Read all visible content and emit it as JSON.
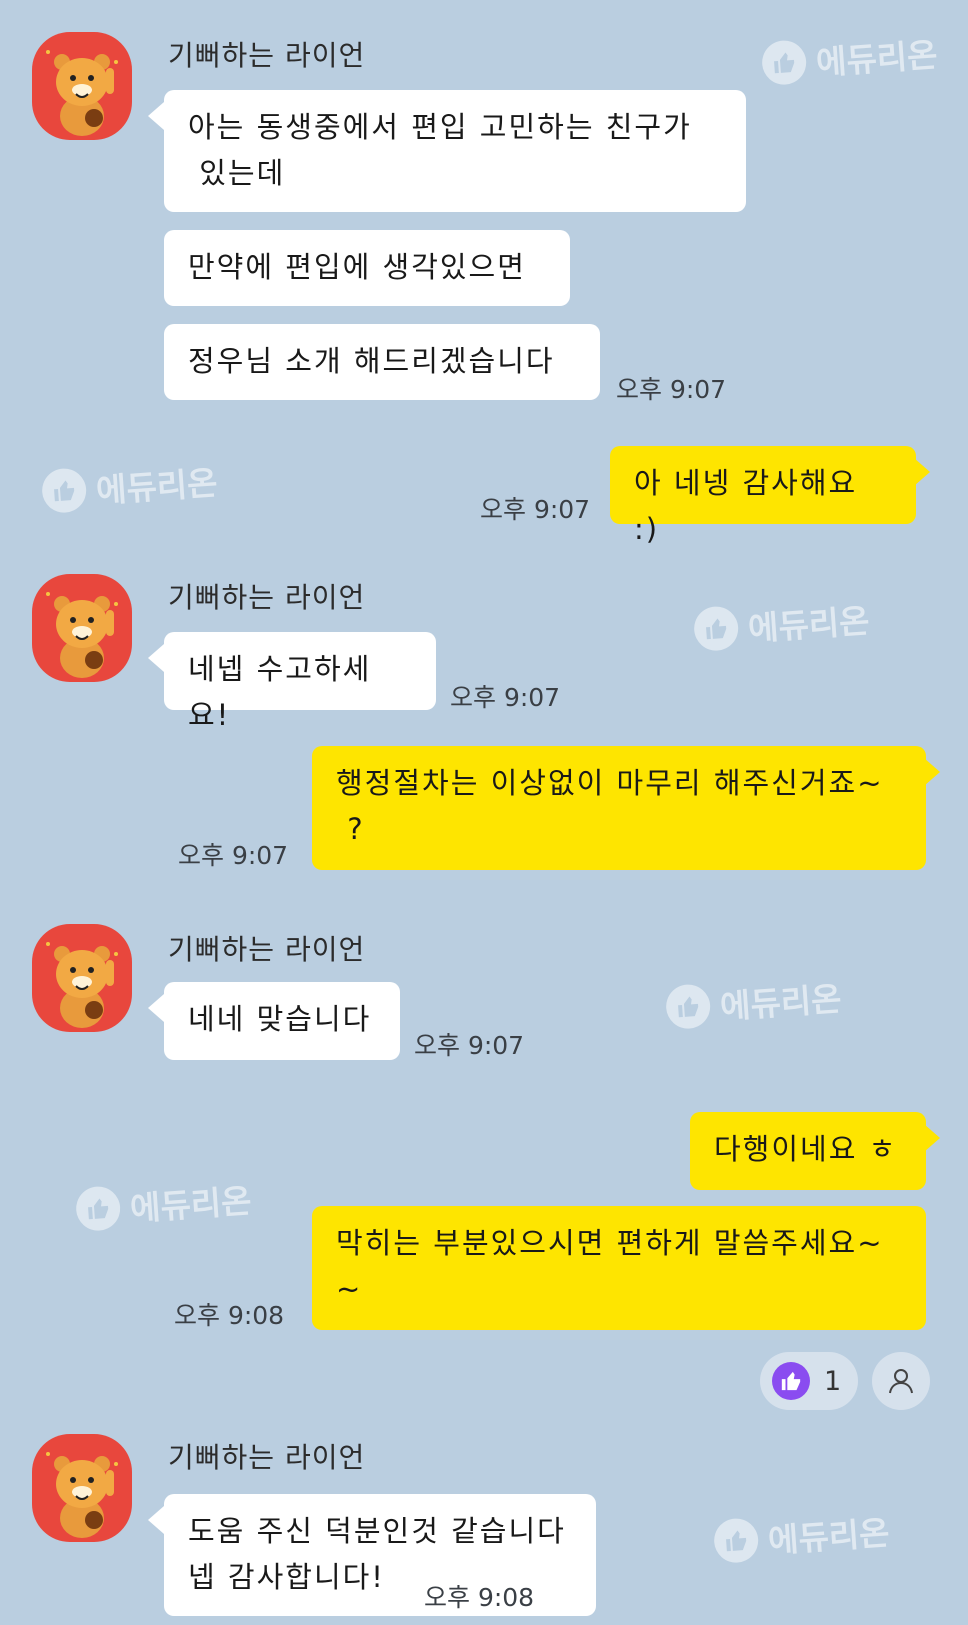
{
  "watermark": "에듀리온",
  "sender_name": "기뻐하는 라이언",
  "messages": [
    {
      "text": "아는 동생중에서 편입 고민하는 친구가\n 있는데"
    },
    {
      "text": "만약에 편입에 생각있으면"
    },
    {
      "text": "정우님 소개 해드리겠습니다",
      "time": "오후 9:07"
    },
    {
      "text": "아 네넹 감사해요 :)",
      "time": "오후 9:07"
    },
    {
      "text": "네넵 수고하세요!",
      "time": "오후 9:07"
    },
    {
      "text": "행정절차는 이상없이 마무리 해주신거죠~\n ?",
      "time": "오후 9:07"
    },
    {
      "text": "네네 맞습니다",
      "time": "오후 9:07"
    },
    {
      "text": "다행이네요 ㅎ"
    },
    {
      "text": "막히는 부분있으시면 편하게 말씀주세요~\n~",
      "time": "오후 9:08"
    },
    {
      "text": "도움 주신 덕분인것 같습니다\n넵 감사합니다!",
      "time": "오후 9:08"
    }
  ],
  "reaction": {
    "icon": "thumbs-up-icon",
    "count": "1",
    "color": "#8a4cf0"
  },
  "colors": {
    "background": "#bacee0",
    "incoming": "#ffffff",
    "outgoing": "#fee500",
    "avatar": "#e8473d"
  }
}
